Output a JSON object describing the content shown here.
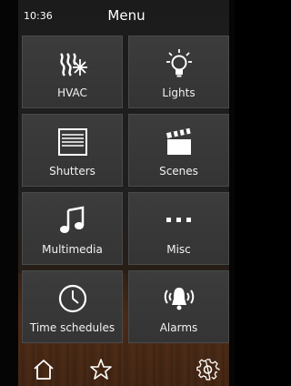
{
  "status": {
    "time": "10:36"
  },
  "header": {
    "title": "Menu"
  },
  "tiles": [
    {
      "label": "HVAC",
      "icon": "hvac-icon"
    },
    {
      "label": "Lights",
      "icon": "lightbulb-icon"
    },
    {
      "label": "Shutters",
      "icon": "shutters-icon"
    },
    {
      "label": "Scenes",
      "icon": "clapperboard-icon"
    },
    {
      "label": "Multimedia",
      "icon": "music-note-icon"
    },
    {
      "label": "Misc",
      "icon": "more-dots-icon"
    },
    {
      "label": "Time schedules",
      "icon": "clock-icon"
    },
    {
      "label": "Alarms",
      "icon": "alarm-bell-icon"
    }
  ],
  "bottom_nav": [
    {
      "icon": "home-icon"
    },
    {
      "icon": "star-icon"
    },
    {
      "icon": "gear-icon"
    }
  ]
}
